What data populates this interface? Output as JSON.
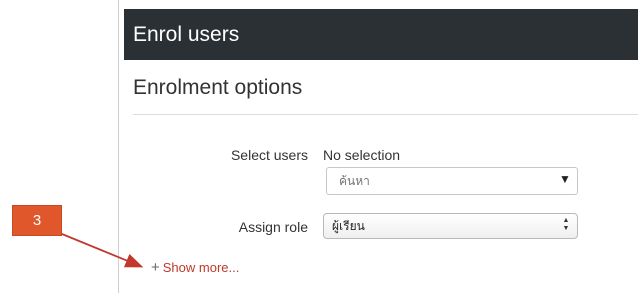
{
  "dialog": {
    "title": "Enrol users",
    "section_title": "Enrolment options"
  },
  "form": {
    "select_users_label": "Select users",
    "select_users_value": "No selection",
    "search_placeholder": "ค้นหา",
    "search_arrow_glyph": "▼",
    "assign_role_label": "Assign role",
    "assign_role_value": "ผู้เรียน",
    "role_chevron_up": "▲",
    "role_chevron_down": "▼"
  },
  "show_more": {
    "icon_glyph": "+",
    "label": "Show more..."
  },
  "callout": {
    "number": "3",
    "color": "#e0572b",
    "arrow_color": "#c0392b"
  },
  "colors": {
    "header_bg": "#2b3035",
    "link": "#c0392b"
  }
}
